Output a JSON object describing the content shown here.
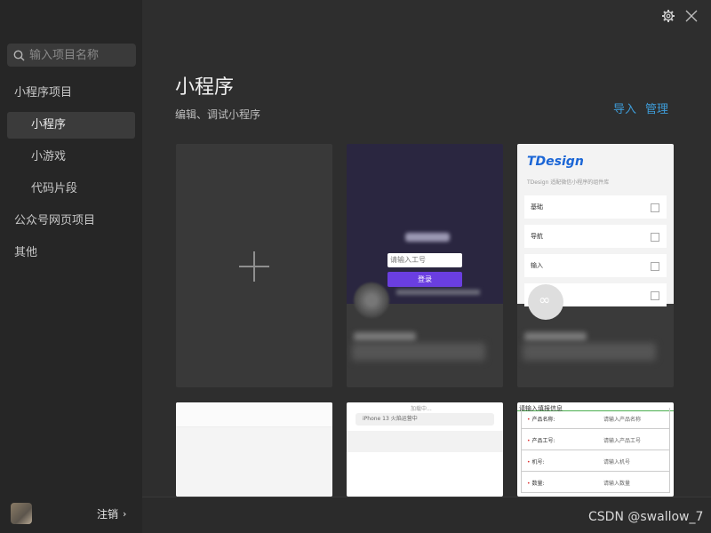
{
  "sidebar": {
    "search_placeholder": "输入项目名称",
    "items": [
      {
        "label": "小程序项目"
      },
      {
        "label": "小程序"
      },
      {
        "label": "小游戏"
      },
      {
        "label": "代码片段"
      },
      {
        "label": "公众号网页项目"
      },
      {
        "label": "其他"
      }
    ],
    "logout_label": "注销",
    "logout_chevron": "›"
  },
  "main": {
    "title": "小程序",
    "subtitle": "编辑、调试小程序",
    "import_label": "导入",
    "manage_label": "管理"
  },
  "cards": {
    "p1": {
      "field": "请输入工号",
      "button": "登录"
    },
    "p2": {
      "logo": "TDesign",
      "sub": "TDesign 适配微信小程序的组件库",
      "rows": [
        {
          "label": "基础"
        },
        {
          "label": "导航"
        },
        {
          "label": "输入"
        }
      ]
    },
    "r2": {
      "loading": "加载中...",
      "hint": "iPhone 13 火焰运营中"
    },
    "r3": {
      "head": "请输入填报信息",
      "rows": [
        {
          "k": "产品名称:",
          "v": "请输入产品名称"
        },
        {
          "k": "产品工号:",
          "v": "请输入产品工号"
        },
        {
          "k": "机号:",
          "v": "请输入机号"
        },
        {
          "k": "数量:",
          "v": "请输入数量"
        }
      ]
    }
  },
  "watermark": "CSDN @swallow_7",
  "icons": {
    "gear": "gear-icon",
    "close": "close-icon",
    "search": "search-icon"
  },
  "colors": {
    "accent": "#3e9cd8",
    "sidebar": "#262626",
    "main": "#2e2e2e"
  }
}
